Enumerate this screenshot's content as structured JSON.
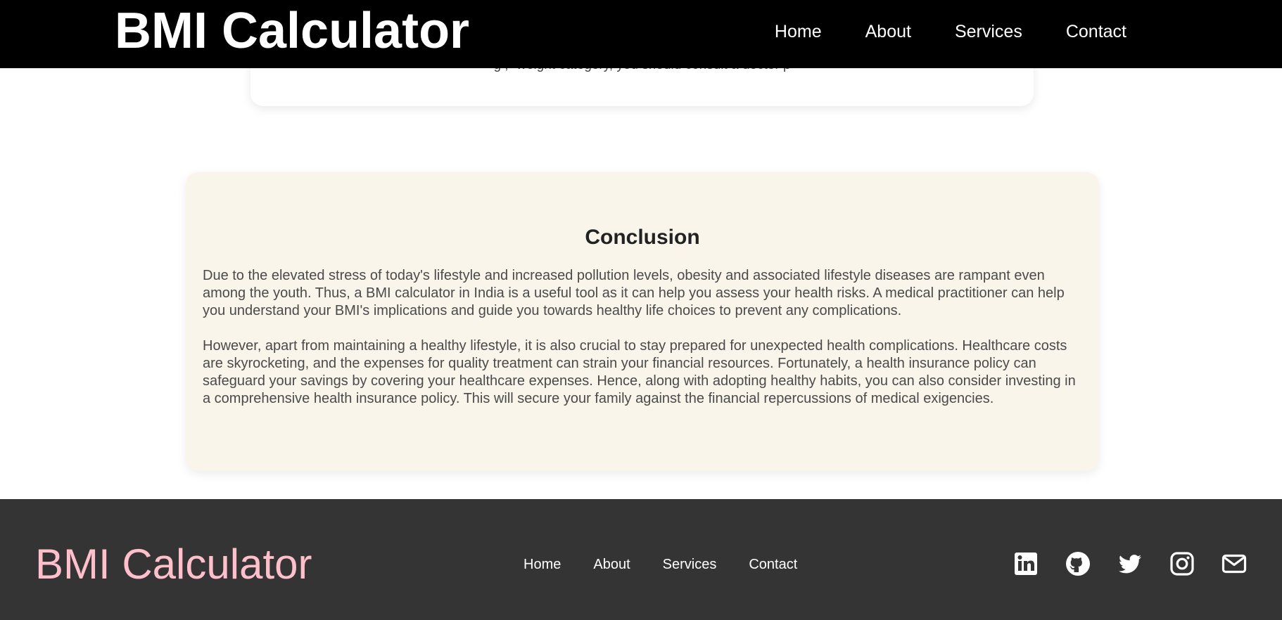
{
  "header": {
    "brand": "BMI Calculator",
    "nav": [
      "Home",
      "About",
      "Services",
      "Contact"
    ]
  },
  "previous_section": {
    "partial_text": "g  ,  -weight category, you    should    consult a doctor   p"
  },
  "conclusion": {
    "title": "Conclusion",
    "paragraph_1": "Due to the elevated stress of today's lifestyle and increased pollution levels, obesity and associated lifestyle diseases are rampant even among the youth. Thus, a BMI calculator in India is a useful tool as it can help you assess your health risks. A medical practitioner can help you understand your BMI's implications and guide you towards healthy life choices to prevent any complications.",
    "paragraph_2": "However, apart from maintaining a healthy lifestyle, it is also crucial to stay prepared for unexpected health complications. Healthcare costs are skyrocketing, and the expenses for quality treatment can strain your financial resources. Fortunately, a health insurance policy can safeguard your savings by covering your healthcare expenses. Hence, along with adopting healthy habits, you can also consider investing in a comprehensive health insurance policy. This will secure your family against the financial repercussions of medical exigencies."
  },
  "footer": {
    "brand": "BMI Calculator",
    "nav": [
      "Home",
      "About",
      "Services",
      "Contact"
    ],
    "social_icons": [
      "linkedin-icon",
      "github-icon",
      "twitter-icon",
      "instagram-icon",
      "mail-icon"
    ]
  },
  "colors": {
    "header_bg": "#000000",
    "footer_bg": "#343434",
    "footer_brand": "#ffc0cb",
    "card_bg": "#f9f5ea"
  }
}
